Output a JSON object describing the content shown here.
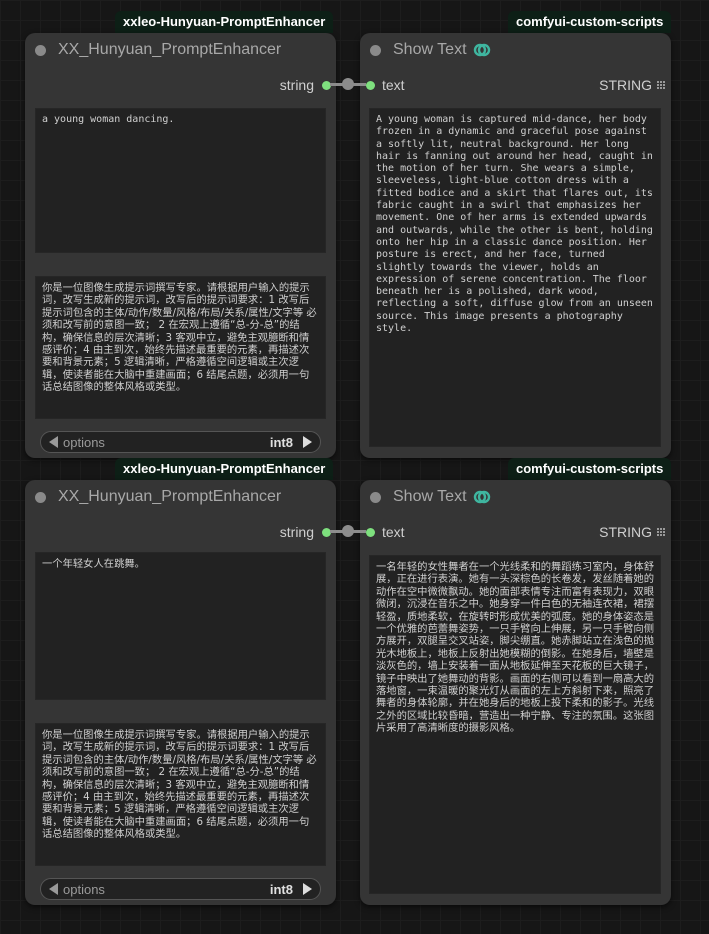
{
  "colors": {
    "canvas_bg": "#161616",
    "node_bg": "#353535",
    "badge_bg": "#0d1f16",
    "socket_green": "#7ee07e",
    "link_gray": "#8c8c8c",
    "icon_teal": "#3fb6a0"
  },
  "groups": [
    {
      "enhancer": {
        "badge": "xxleo-Hunyuan-PromptEnhancer",
        "title": "XX_Hunyuan_PromptEnhancer",
        "output_label": "string",
        "prompt": "a young woman dancing.",
        "system_prompt": "你是一位图像生成提示词撰写专家。请根据用户输入的提示词，改写生成新的提示词，改写后的提示词要求：1 改写后提示词包含的主体/动作/数量/风格/布局/关系/属性/文字等 必须和改写前的意图一致； 2 在宏观上遵循“总-分-总”的结构，确保信息的层次清晰；3 客观中立，避免主观臆断和情感评价；4 由主到次，始终先描述最重要的元素，再描述次要和背景元素；5 逻辑清晰，严格遵循空间逻辑或主次逻辑，使读者能在大脑中重建画面；6 结尾点题，必须用一句话总结图像的整体风格或类型。",
        "options_label": "options",
        "options_value": "int8"
      },
      "show_text": {
        "badge": "comfyui-custom-scripts",
        "title": "Show Text",
        "icon": "link-icon",
        "input_label": "text",
        "output_label": "STRING",
        "text": "A young woman is captured mid-dance, her body frozen in a dynamic and graceful pose against a softly lit, neutral background. Her long hair is fanning out around her head, caught in the motion of her turn. She wears a simple, sleeveless, light-blue cotton dress with a fitted bodice and a skirt that flares out, its fabric caught in a swirl that emphasizes her movement. One of her arms is extended upwards and outwards, while the other is bent, holding onto her hip in a classic dance position. Her posture is erect, and her face, turned slightly towards the viewer, holds an expression of serene concentration. The floor beneath her is a polished, dark wood, reflecting a soft, diffuse glow from an unseen source. This image presents a photography style."
      }
    },
    {
      "enhancer": {
        "badge": "xxleo-Hunyuan-PromptEnhancer",
        "title": "XX_Hunyuan_PromptEnhancer",
        "output_label": "string",
        "prompt": "一个年轻女人在跳舞。",
        "system_prompt": "你是一位图像生成提示词撰写专家。请根据用户输入的提示词，改写生成新的提示词，改写后的提示词要求：1 改写后提示词包含的主体/动作/数量/风格/布局/关系/属性/文字等 必须和改写前的意图一致； 2 在宏观上遵循“总-分-总”的结构，确保信息的层次清晰；3 客观中立，避免主观臆断和情感评价；4 由主到次，始终先描述最重要的元素，再描述次要和背景元素；5 逻辑清晰，严格遵循空间逻辑或主次逻辑，使读者能在大脑中重建画面；6 结尾点题，必须用一句话总结图像的整体风格或类型。",
        "options_label": "options",
        "options_value": "int8"
      },
      "show_text": {
        "badge": "comfyui-custom-scripts",
        "title": "Show Text",
        "icon": "link-icon",
        "input_label": "text",
        "output_label": "STRING",
        "text": "一名年轻的女性舞者在一个光线柔和的舞蹈练习室内，身体舒展，正在进行表演。她有一头深棕色的长卷发，发丝随着她的动作在空中微微飘动。她的面部表情专注而富有表现力，双眼微闭，沉浸在音乐之中。她身穿一件白色的无袖连衣裙，裙摆轻盈，质地柔软，在旋转时形成优美的弧度。她的身体姿态是一个优雅的芭蕾舞姿势，一只手臂向上伸展，另一只手臂向侧方展开，双腿呈交叉站姿，脚尖绷直。她赤脚站立在浅色的抛光木地板上，地板上反射出她模糊的倒影。在她身后，墙壁是淡灰色的，墙上安装着一面从地板延伸至天花板的巨大镜子，镜子中映出了她舞动的背影。画面的右侧可以看到一扇高大的落地窗，一束温暖的聚光灯从画面的左上方斜射下来，照亮了舞者的身体轮廓，并在她身后的地板上投下柔和的影子。光线之外的区域比较昏暗，营造出一种宁静、专注的氛围。这张图片采用了高清晰度的摄影风格。"
      }
    }
  ]
}
